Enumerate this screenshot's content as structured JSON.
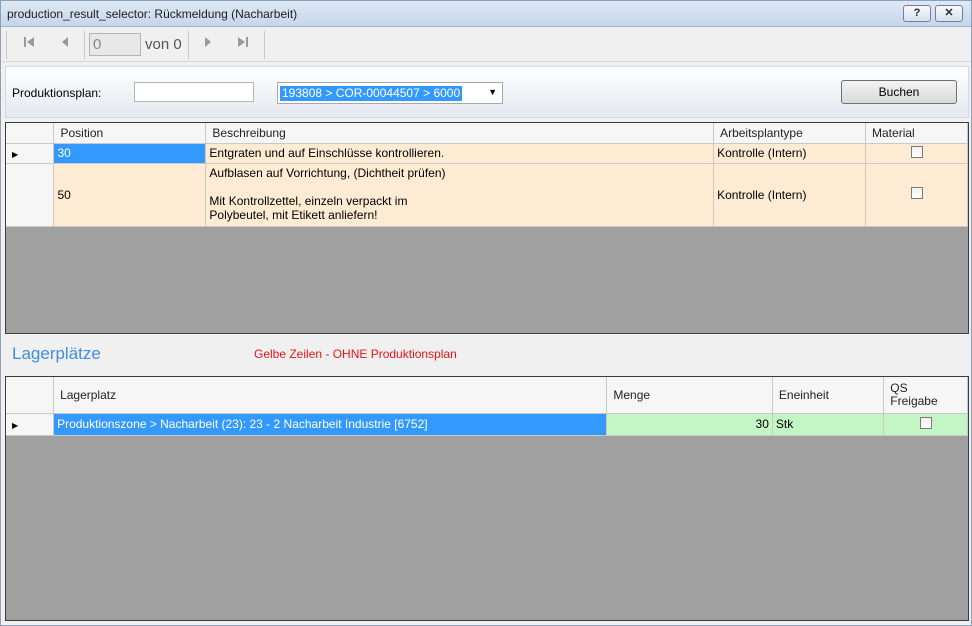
{
  "window": {
    "title": "production_result_selector: Rückmeldung (Nacharbeit)",
    "help_label": "?",
    "close_label": "✕"
  },
  "toolbar": {
    "position_value": "0",
    "of_label": "von 0",
    "first_icon": "skip-first-icon",
    "prev_icon": "prev-icon",
    "next_icon": "next-icon",
    "last_icon": "skip-last-icon"
  },
  "filter": {
    "plan_label": "Produktionsplan:",
    "plan_input_value": "",
    "plan_select_value": "193808 > COR-00044507 > 6000",
    "book_button_label": "Buchen"
  },
  "positions_grid": {
    "columns": [
      "Position",
      "Beschreibung",
      "Arbeitsplantype",
      "Material"
    ],
    "rows": [
      {
        "position": "30",
        "description": [
          "Entgraten und auf Einschlüsse kontrollieren."
        ],
        "type": "Kontrolle (Intern)",
        "material": false,
        "current": true
      },
      {
        "position": "50",
        "description": [
          "Aufblasen auf Vorrichtung, (Dichtheit prüfen)",
          "",
          "Mit Kontrollzettel, einzeln verpackt im",
          "Polybeutel, mit Etikett anliefern!"
        ],
        "type": "Kontrolle (Intern)",
        "material": false,
        "current": false
      }
    ]
  },
  "storage": {
    "title": "Lagerplätze",
    "hint": "Gelbe Zeilen - OHNE Produktionsplan",
    "columns": [
      "Lagerplatz",
      "Menge",
      "Eneinheit",
      "QS\nFreigabe"
    ],
    "rows": [
      {
        "location": "Produktionszone > Nacharbeit (23): 23 - 2 Nacharbeit Industrie [6752]",
        "quantity": "30",
        "unit": "Stk",
        "qs_release": false
      }
    ]
  },
  "colors": {
    "accent": "#3d8fe0",
    "selection": "#3399ff",
    "hint_red": "#e81414",
    "row_tan": "#fdebd3",
    "row_green": "#c4f5c4"
  }
}
